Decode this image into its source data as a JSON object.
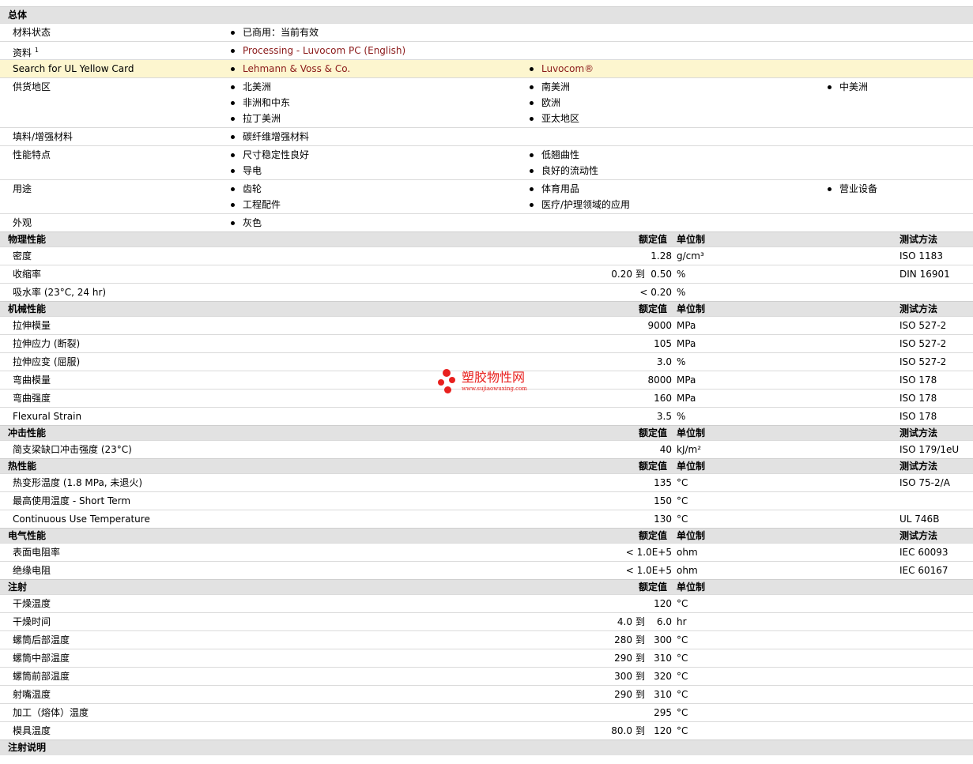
{
  "general": {
    "title": "总体",
    "rows": [
      {
        "label": "材料状态",
        "items": [
          "已商用：当前有效"
        ]
      },
      {
        "label": "资料",
        "sup": "1",
        "items": [
          "Processing - Luvocom PC (English)"
        ]
      },
      {
        "label": "Search for UL Yellow Card",
        "items": [
          "Lehmann & Voss & Co.",
          "Luvocom®"
        ]
      },
      {
        "label": "供货地区",
        "items": [
          "北美洲",
          "南美洲",
          "中美洲",
          "非洲和中东",
          "欧洲",
          "拉丁美洲",
          "亚太地区"
        ]
      },
      {
        "label": "填料/增强材料",
        "items": [
          "碳纤维增强材料"
        ]
      },
      {
        "label": "性能特点",
        "items": [
          "尺寸稳定性良好",
          "低翘曲性",
          "导电",
          "良好的流动性"
        ]
      },
      {
        "label": "用途",
        "items": [
          "齿轮",
          "体育用品",
          "营业设备",
          "工程配件",
          "医疗/护理领域的应用"
        ]
      },
      {
        "label": "外观",
        "items": [
          "灰色"
        ]
      }
    ]
  },
  "headers": {
    "nominal": "额定值",
    "unit": "单位制",
    "method": "测试方法",
    "range_sep": "到"
  },
  "sections": [
    {
      "title": "物理性能",
      "rows": [
        {
          "label": "密度",
          "lo": "",
          "value": "1.28",
          "unit": "g/cm³",
          "method": "ISO 1183"
        },
        {
          "label": "收缩率",
          "lo": "0.20",
          "value": "0.50",
          "unit": "%",
          "method": "DIN 16901"
        },
        {
          "label": "吸水率 (23°C, 24 hr)",
          "lo": "",
          "value": "< 0.20",
          "unit": "%",
          "method": ""
        }
      ]
    },
    {
      "title": "机械性能",
      "rows": [
        {
          "label": "拉伸模量",
          "lo": "",
          "value": "9000",
          "unit": "MPa",
          "method": "ISO 527-2"
        },
        {
          "label": "拉伸应力 (断裂)",
          "lo": "",
          "value": "105",
          "unit": "MPa",
          "method": "ISO 527-2"
        },
        {
          "label": "拉伸应变 (屈服)",
          "lo": "",
          "value": "3.0",
          "unit": "%",
          "method": "ISO 527-2"
        },
        {
          "label": "弯曲模量",
          "lo": "",
          "value": "8000",
          "unit": "MPa",
          "method": "ISO 178"
        },
        {
          "label": "弯曲强度",
          "lo": "",
          "value": "160",
          "unit": "MPa",
          "method": "ISO 178"
        },
        {
          "label": "Flexural Strain",
          "lo": "",
          "value": "3.5",
          "unit": "%",
          "method": "ISO 178"
        }
      ]
    },
    {
      "title": "冲击性能",
      "rows": [
        {
          "label": "简支梁缺口冲击强度 (23°C)",
          "lo": "",
          "value": "40",
          "unit": "kJ/m²",
          "method": "ISO 179/1eU"
        }
      ]
    },
    {
      "title": "热性能",
      "rows": [
        {
          "label": "热变形温度 (1.8 MPa, 未退火)",
          "lo": "",
          "value": "135",
          "unit": "°C",
          "method": "ISO 75-2/A"
        },
        {
          "label": "最高使用温度 - Short Term",
          "lo": "",
          "value": "150",
          "unit": "°C",
          "method": ""
        },
        {
          "label": "Continuous Use Temperature",
          "lo": "",
          "value": "130",
          "unit": "°C",
          "method": "UL 746B"
        }
      ]
    },
    {
      "title": "电气性能",
      "rows": [
        {
          "label": "表面电阻率",
          "lo": "",
          "value": "< 1.0E+5",
          "unit": "ohm",
          "method": "IEC 60093"
        },
        {
          "label": "绝缘电阻",
          "lo": "",
          "value": "< 1.0E+5",
          "unit": "ohm",
          "method": "IEC 60167"
        }
      ]
    },
    {
      "title": "注射",
      "rows": [
        {
          "label": "干燥温度",
          "lo": "",
          "value": "120",
          "unit": "°C",
          "method": ""
        },
        {
          "label": "干燥时间",
          "lo": "4.0",
          "value": "6.0",
          "unit": "hr",
          "method": ""
        },
        {
          "label": "螺筒后部温度",
          "lo": "280",
          "value": "300",
          "unit": "°C",
          "method": ""
        },
        {
          "label": "螺筒中部温度",
          "lo": "290",
          "value": "310",
          "unit": "°C",
          "method": ""
        },
        {
          "label": "螺筒前部温度",
          "lo": "300",
          "value": "320",
          "unit": "°C",
          "method": ""
        },
        {
          "label": "射嘴温度",
          "lo": "290",
          "value": "310",
          "unit": "°C",
          "method": ""
        },
        {
          "label": "加工（熔体）温度",
          "lo": "",
          "value": "295",
          "unit": "°C",
          "method": ""
        },
        {
          "label": "模具温度",
          "lo": "80.0",
          "value": "120",
          "unit": "°C",
          "method": ""
        }
      ]
    },
    {
      "title": "注射说明",
      "rows": []
    }
  ],
  "watermark": {
    "title": "塑胶物性网",
    "url": "www.sujiaowuxing.com",
    "color": "#e8201e"
  },
  "colors": {
    "section_bg": "#e2e2e2",
    "highlight_bg": "#fdf6cf",
    "link": "#8b1a1a"
  }
}
